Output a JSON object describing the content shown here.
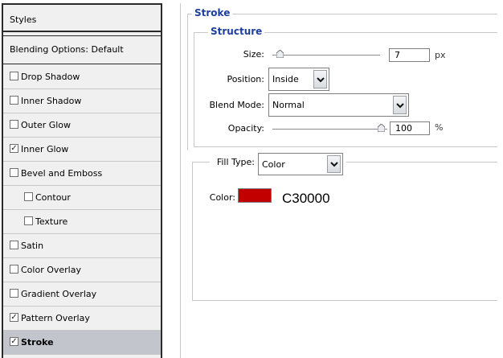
{
  "sidebar": {
    "header": "Styles",
    "blending_options": "Blending Options: Default",
    "items": [
      {
        "label": "Drop Shadow",
        "checked": false
      },
      {
        "label": "Inner Shadow",
        "checked": false
      },
      {
        "label": "Outer Glow",
        "checked": false
      },
      {
        "label": "Inner Glow",
        "checked": true
      },
      {
        "label": "Bevel and Emboss",
        "checked": false
      },
      {
        "label": "Contour",
        "checked": false
      },
      {
        "label": "Texture",
        "checked": false
      },
      {
        "label": "Satin",
        "checked": false
      },
      {
        "label": "Color Overlay",
        "checked": false
      },
      {
        "label": "Gradient Overlay",
        "checked": false
      },
      {
        "label": "Pattern Overlay",
        "checked": true
      },
      {
        "label": "Stroke",
        "checked": true,
        "selected": true
      }
    ]
  },
  "stroke": {
    "title": "Stroke",
    "structure_title": "Structure",
    "size_label": "Size:",
    "size_value": "7",
    "size_unit": "px",
    "position_label": "Position:",
    "position_value": "Inside",
    "blend_mode_label": "Blend Mode:",
    "blend_mode_value": "Normal",
    "opacity_label": "Opacity:",
    "opacity_value": "100",
    "opacity_unit": "%",
    "fill_type_label": "Fill Type:",
    "fill_type_value": "Color",
    "color_label": "Color:",
    "color_hex": "C30000",
    "color_swatch": "#C30000"
  },
  "colors": {
    "section_title": "#1f3f9f",
    "selected_item_bg": "#c2c6cc",
    "panel_bg": "#f0f0f0"
  }
}
